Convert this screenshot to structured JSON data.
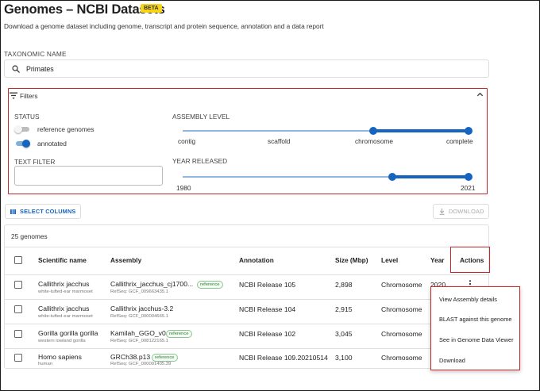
{
  "header": {
    "title": "Genomes – NCBI Datasets",
    "badge": "BETA",
    "subtitle": "Download a genome dataset including genome, transcript and protein sequence, annotation and a data report"
  },
  "taxonomy": {
    "label": "TAXONOMIC NAME",
    "value": "Primates",
    "icon": "search-icon"
  },
  "filters": {
    "title": "Filters",
    "status_label": "STATUS",
    "toggles": [
      {
        "label": "reference genomes",
        "on": false
      },
      {
        "label": "annotated",
        "on": true
      }
    ],
    "text_filter_label": "TEXT FILTER",
    "text_filter_value": "",
    "assembly_level": {
      "label": "ASSEMBLY LEVEL",
      "levels": [
        "contig",
        "scaffold",
        "chromosome",
        "complete"
      ],
      "selected_range": [
        "chromosome",
        "complete"
      ]
    },
    "year_released": {
      "label": "YEAR RELEASED",
      "min": "1980",
      "max": "2021",
      "selected_range": [
        2014,
        2021
      ]
    }
  },
  "toolbar": {
    "select_columns_label": "SELECT COLUMNS",
    "download_label": "DOWNLOAD"
  },
  "table": {
    "count_label": "25 genomes",
    "columns": [
      "Scientific name",
      "Assembly",
      "Annotation",
      "Size (Mbp)",
      "Level",
      "Year",
      "Actions"
    ],
    "rows": [
      {
        "name": "Callithrix jacchus",
        "common": "white-tufted-ear marmoset",
        "assembly": "Callithrix_jacchus_cj1700...",
        "reference": "reference",
        "refseq": "RefSeq: GCF_009663435.1",
        "annotation": "NCBI Release 105",
        "size": "2,898",
        "level": "Chromosome",
        "year": "2020"
      },
      {
        "name": "Callithrix jacchus",
        "common": "white-tufted-ear marmoset",
        "assembly": "Callithrix jacchus-3.2",
        "reference": "",
        "refseq": "RefSeq: GCF_000004665.1",
        "annotation": "NCBI Release 104",
        "size": "2,915",
        "level": "Chromosome",
        "year": ""
      },
      {
        "name": "Gorilla gorilla gorilla",
        "common": "western lowland gorilla",
        "assembly": "Kamilah_GGO_v0",
        "reference": "reference",
        "refseq": "RefSeq: GCF_008122165.1",
        "annotation": "NCBI Release 102",
        "size": "3,045",
        "level": "Chromosome",
        "year": ""
      },
      {
        "name": "Homo sapiens",
        "common": "human",
        "assembly": "GRCh38.p13",
        "reference": "reference",
        "refseq": "RefSeq: GCF_000001405.39",
        "annotation": "NCBI Release 109.20210514",
        "size": "3,100",
        "level": "Chromosome",
        "year": ""
      }
    ]
  },
  "actions_menu": {
    "items": [
      "View Assembly details",
      "BLAST against this genome",
      "See in Genome Data Viewer",
      "Download"
    ]
  },
  "colors": {
    "accent": "#1565c0",
    "highlight": "#c62828",
    "badge": "#f8d51b",
    "reference_badge": "#2e7d32"
  }
}
